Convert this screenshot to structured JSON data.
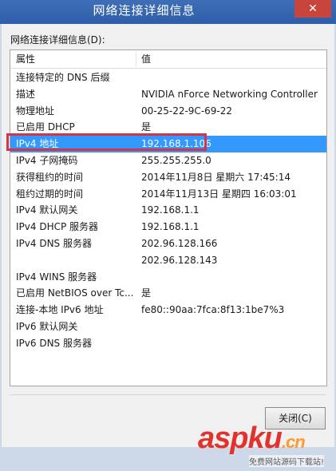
{
  "window": {
    "title": "网络连接详细信息",
    "close_glyph": "✕"
  },
  "group_label": "网络连接详细信息(D):",
  "table": {
    "columns": [
      "属性",
      "值"
    ],
    "rows": [
      {
        "prop": "连接特定的 DNS 后缀",
        "val": ""
      },
      {
        "prop": "描述",
        "val": "NVIDIA nForce Networking Controller"
      },
      {
        "prop": "物理地址",
        "val": "00-25-22-9C-69-22"
      },
      {
        "prop": "已启用 DHCP",
        "val": "是"
      },
      {
        "prop": "IPv4 地址",
        "val": "192.168.1.106",
        "selected": true
      },
      {
        "prop": "IPv4 子网掩码",
        "val": "255.255.255.0"
      },
      {
        "prop": "获得租约的时间",
        "val": "2014年11月8日 星期六 17:45:14"
      },
      {
        "prop": "租约过期的时间",
        "val": "2014年11月13日 星期四 16:03:01"
      },
      {
        "prop": "IPv4 默认网关",
        "val": "192.168.1.1"
      },
      {
        "prop": "IPv4 DHCP 服务器",
        "val": "192.168.1.1"
      },
      {
        "prop": "IPv4 DNS 服务器",
        "val": "202.96.128.166"
      },
      {
        "prop": "",
        "val": "202.96.128.143"
      },
      {
        "prop": "IPv4 WINS 服务器",
        "val": ""
      },
      {
        "prop": "已启用 NetBIOS over Tc...",
        "val": "是"
      },
      {
        "prop": "连接-本地 IPv6 地址",
        "val": "fe80::90aa:7fca:8f13:1be7%3"
      },
      {
        "prop": "IPv6 默认网关",
        "val": ""
      },
      {
        "prop": "IPv6 DNS 服务器",
        "val": ""
      }
    ]
  },
  "buttons": {
    "close_label": "关闭(C)"
  },
  "watermark": {
    "logo_asp": "asp",
    "logo_ku": "ku",
    "logo_cn": ".cn",
    "subtitle": "免费网站源码下载站!"
  },
  "colors": {
    "selection": "#3399ff",
    "highlight_border": "#d0354a",
    "titlebar": "#3a69b4"
  }
}
